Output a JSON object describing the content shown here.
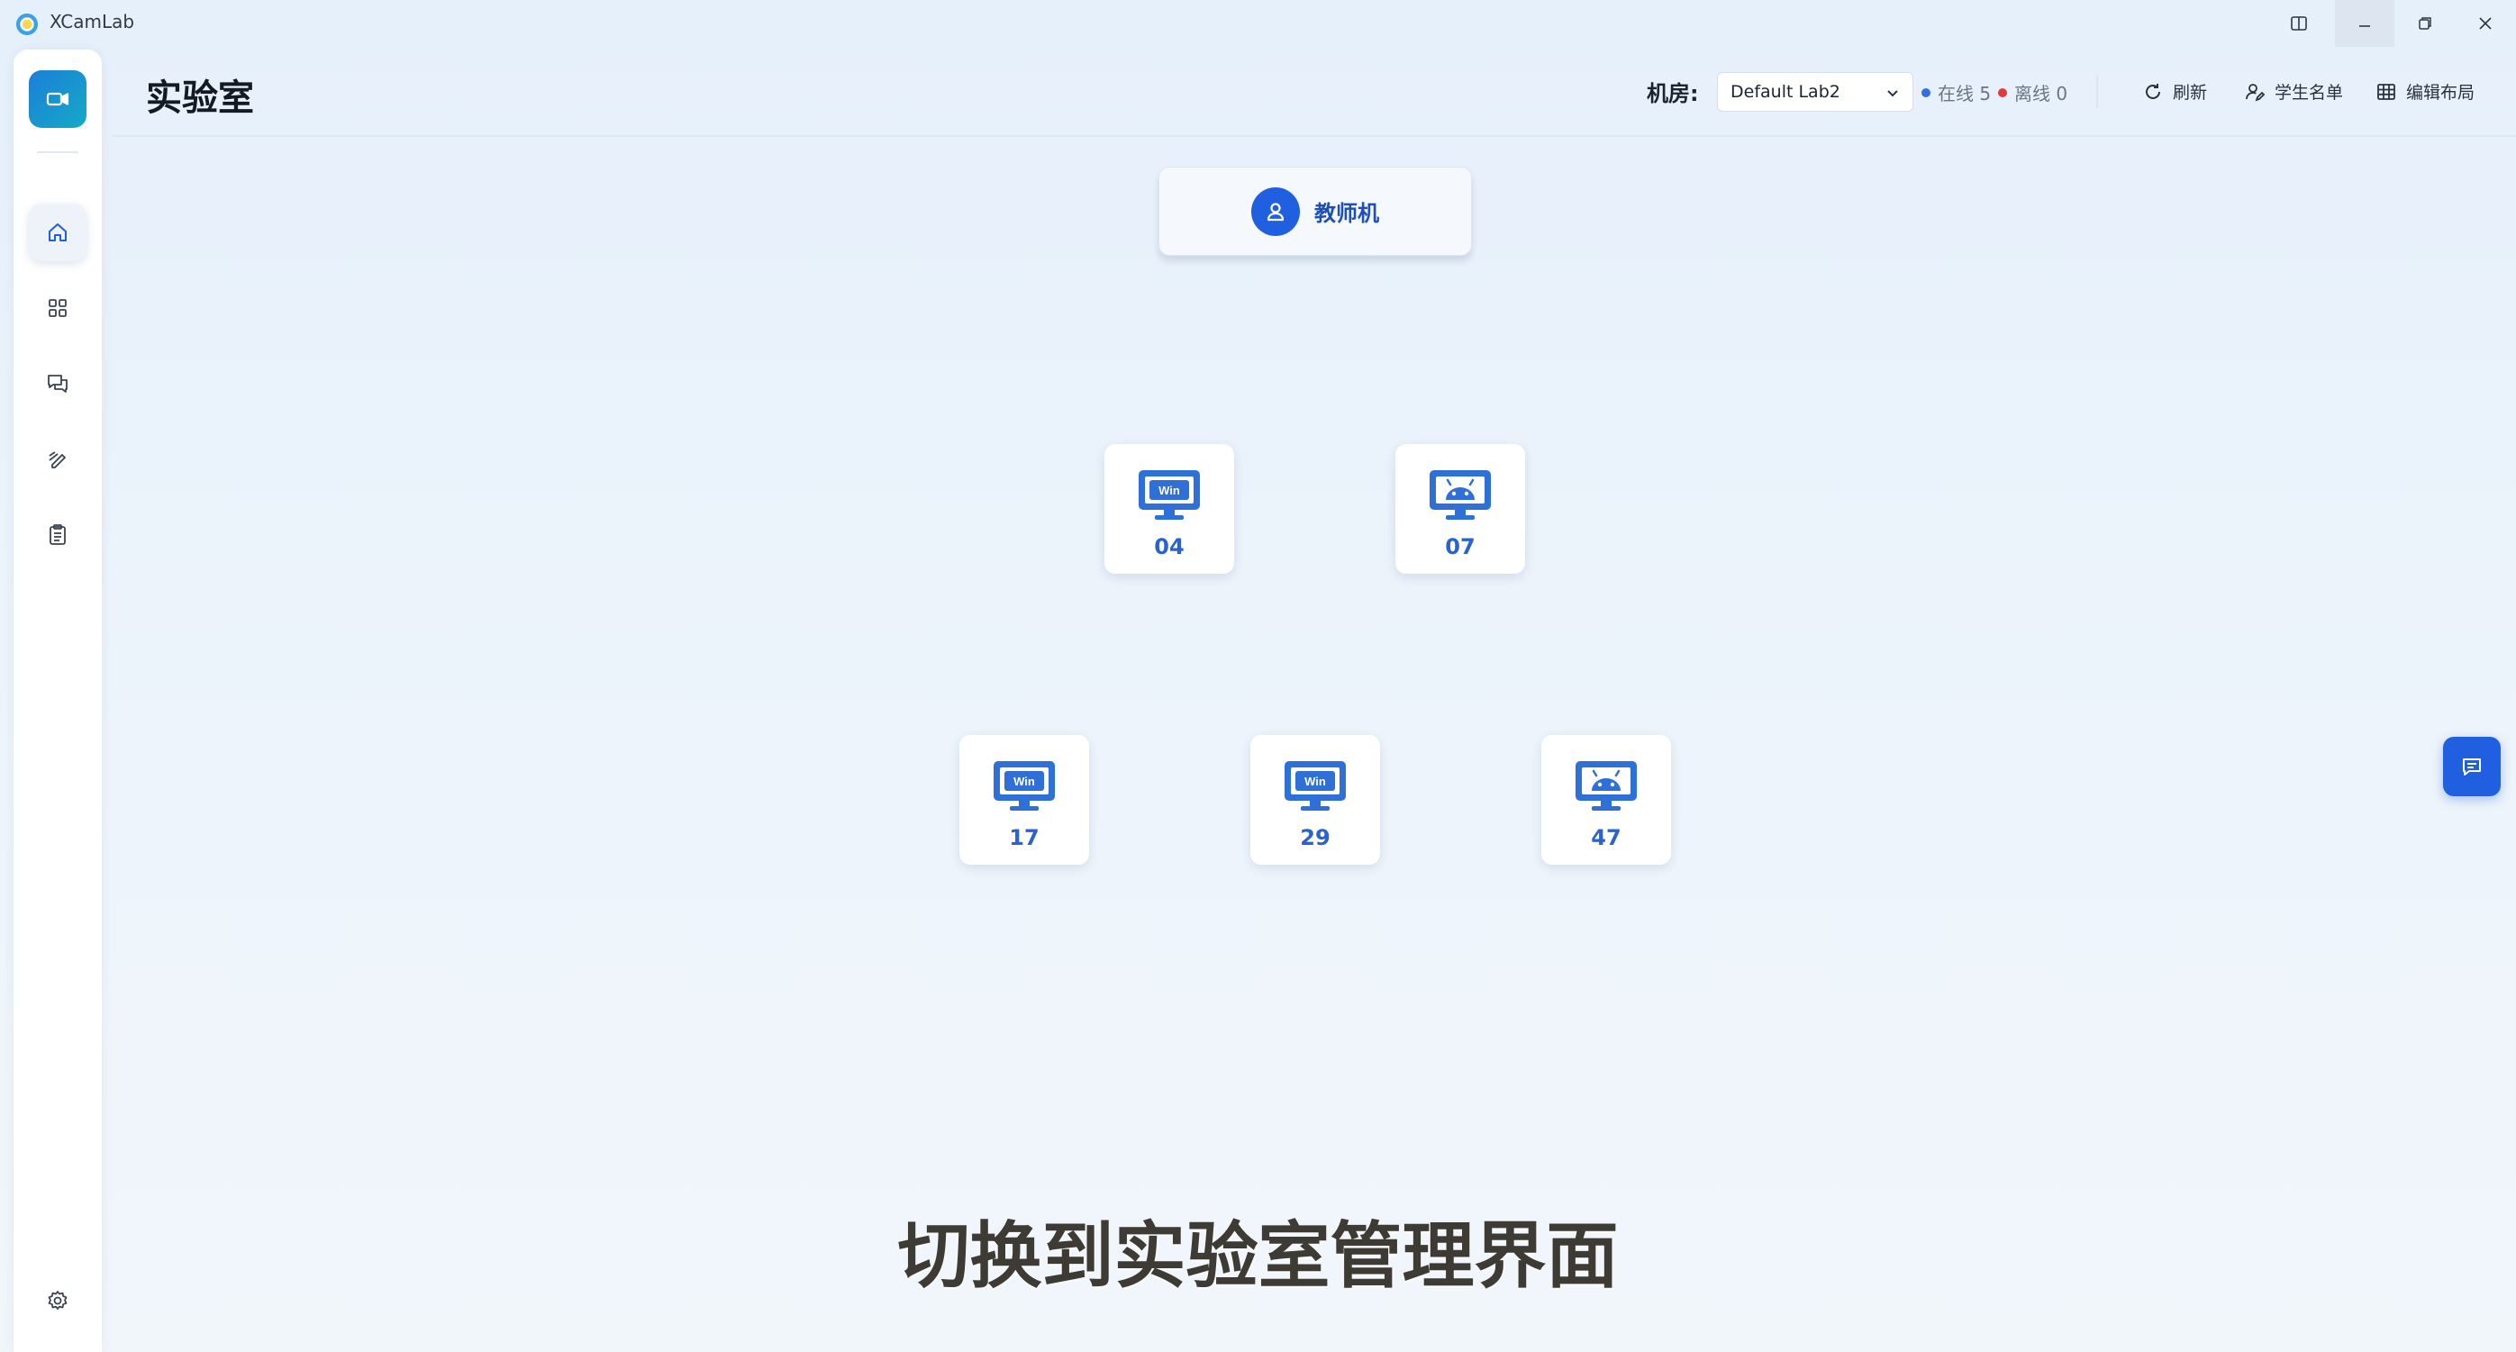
{
  "window": {
    "title": "XCamLab",
    "controls": [
      "split-view-icon",
      "minimize-icon",
      "restore-icon",
      "close-icon"
    ]
  },
  "sidebar": {
    "logo_icon": "video-camera-icon",
    "items": [
      {
        "icon": "home-icon",
        "active": true
      },
      {
        "icon": "grid-icon",
        "active": false
      },
      {
        "icon": "chat-icon",
        "active": false
      },
      {
        "icon": "edit-icon",
        "active": false
      },
      {
        "icon": "clipboard-icon",
        "active": false
      }
    ],
    "settings_icon": "gear-icon"
  },
  "header": {
    "title": "实验室",
    "room_label": "机房:",
    "room_selected": "Default Lab2",
    "online_text": "在线 5",
    "offline_text": "离线 0",
    "refresh_label": "刷新",
    "students_label": "学生名单",
    "layout_label": "编辑布局"
  },
  "colors": {
    "accent": "#1f5fe0",
    "online": "#2f6fe0",
    "offline": "#e03a3a",
    "device_icon": "#2f6fd8"
  },
  "teacher": {
    "label": "教师机",
    "icon": "user-icon"
  },
  "seats": [
    {
      "number": "04",
      "os": "windows"
    },
    {
      "number": "07",
      "os": "android"
    },
    {
      "number": "17",
      "os": "windows"
    },
    {
      "number": "29",
      "os": "windows"
    },
    {
      "number": "47",
      "os": "android"
    }
  ],
  "float_button": {
    "icon": "message-icon"
  },
  "caption": "切换到实验室管理界面"
}
